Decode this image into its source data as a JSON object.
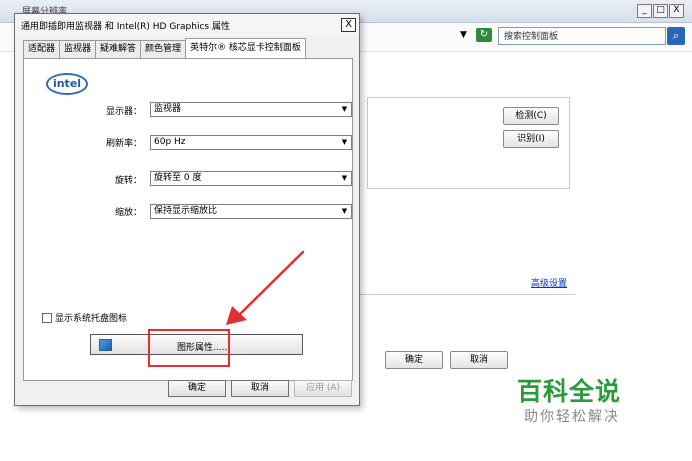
{
  "background_window": {
    "title": "屏幕分辨率",
    "min_label": "_",
    "max_label": "□",
    "close_label": "X",
    "refresh_icon": "refresh-icon",
    "search_placeholder": "搜索控制面板",
    "search_icon": "search-icon",
    "detect_button": "检测(C)",
    "identify_button": "识别(I)",
    "advanced_link": "高级设置",
    "ok_button": "确定",
    "cancel_button": "取消"
  },
  "dialog": {
    "title": "通用即插即用监视器 和 Intel(R) HD Graphics 属性",
    "close_label": "X",
    "tabs": [
      {
        "label": "适配器"
      },
      {
        "label": "监视器"
      },
      {
        "label": "疑难解答"
      },
      {
        "label": "颜色管理"
      },
      {
        "label": "英特尔® 核芯显卡控制面板"
      }
    ],
    "logo_text": "intel",
    "fields": {
      "display": {
        "label": "显示器：",
        "value": "监视器"
      },
      "refresh": {
        "label": "刷新率：",
        "value": "60p Hz"
      },
      "rotation": {
        "label": "旋转：",
        "value": "旋转至 0 度"
      },
      "scaling": {
        "label": "缩放：",
        "value": "保持显示缩放比"
      }
    },
    "tray_checkbox_label": "显示系统托盘图标",
    "graphics_button_label": "图形属性......",
    "ok_button": "确定",
    "cancel_button": "取消",
    "apply_button": "应用 (A)"
  },
  "watermark": {
    "title": "百科全说",
    "subtitle": "助你轻松解决"
  },
  "colors": {
    "annotation_red": "#e03030",
    "watermark_green": "#2a9a3a"
  }
}
